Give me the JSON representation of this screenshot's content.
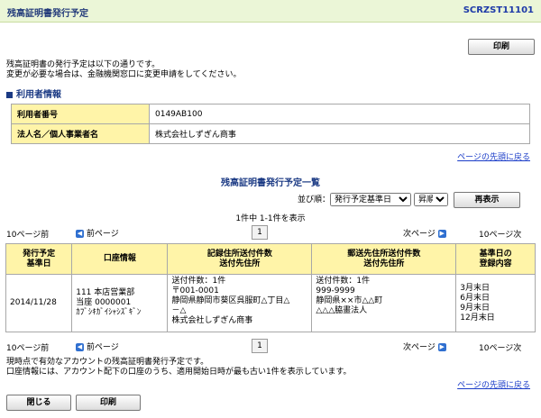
{
  "header": {
    "title": "残高証明書発行予定",
    "screen_id": "SCRZST11101"
  },
  "toolbar": {
    "print_label": "印刷"
  },
  "intro": [
    "残高証明書の発行予定は以下の通りです。",
    "変更が必要な場合は、金融機関窓口に変更申請をしてください。"
  ],
  "user_info": {
    "section_title": "利用者情報",
    "rows": [
      {
        "label": "利用者番号",
        "value": "0149AB100"
      },
      {
        "label": "法人名／個人事業者名",
        "value": "株式会社しずぎん商事"
      }
    ]
  },
  "to_top_link": "ページの先頭に戻る",
  "list": {
    "title": "残高証明書発行予定一覧",
    "sort_label": "並び順：",
    "sort_field": "発行予定基準日",
    "sort_order": "昇順",
    "redisplay_label": "再表示",
    "count_text": "1件中 1-1件を表示",
    "pager": {
      "prev10": "10ページ前",
      "prev": "前ページ",
      "page": "1",
      "next": "次ページ",
      "next10": "10ページ次"
    },
    "columns": [
      "発行予定\n基準日",
      "口座情報",
      "記録住所送付件数\n送付先住所",
      "郵送先住所送付件数\n送付先住所",
      "基準日の\n登録内容"
    ],
    "rows": [
      {
        "date": "2014/11/28",
        "account": "111 本店営業部\n当座 0000001\nｶﾌﾞｼｷｶﾞｲｼｬｼｽﾞｷﾞﾝ",
        "record_address": "送付件数：1件\n〒001-0001\n静岡県静岡市葵区呉服町△丁目△\n－△\n株式会社しずぎん商事",
        "mail_address": "送付件数：1件\n999-9999\n静岡県××市△△町\n△△△脇畫法人",
        "registration": "3月末日\n6月末日\n9月末日\n12月末日"
      }
    ]
  },
  "footnotes": [
    "現時点で有効なアカウントの残高証明書発行予定です。",
    "口座情報には、アカウント配下の口座のうち、適用開始日時が最も古い1件を表示しています。"
  ],
  "bottom_buttons": {
    "close_label": "閉じる",
    "print_label": "印刷"
  }
}
